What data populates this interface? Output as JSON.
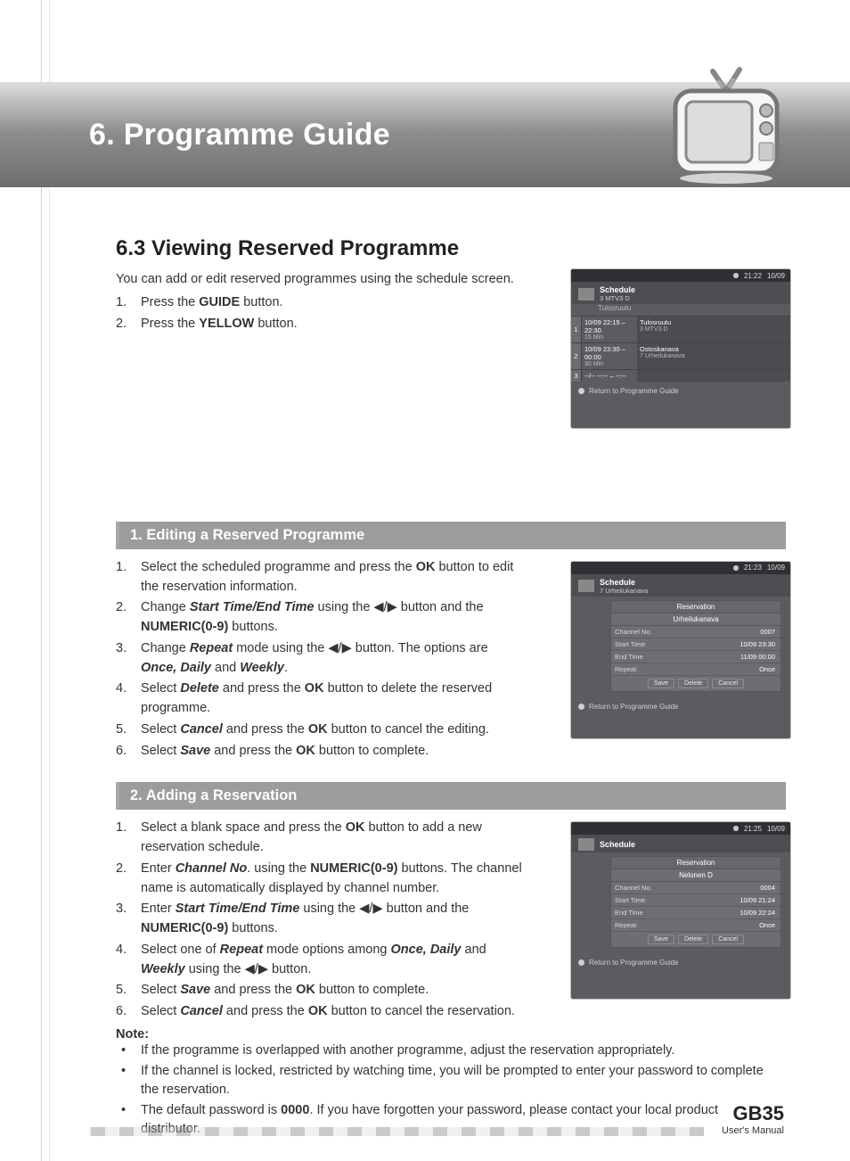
{
  "chapter": {
    "title": "6. Programme Guide"
  },
  "section": {
    "number": "6.3",
    "title": "6.3 Viewing Reserved Programme",
    "intro": "You can add or edit reserved programmes using the schedule screen.",
    "steps": {
      "s1a": "Press the ",
      "s1b": "GUIDE",
      "s1c": " button.",
      "s2a": "Press the ",
      "s2b": "YELLOW",
      "s2c": " button."
    }
  },
  "sub1": {
    "heading": "1. Editing a Reserved Programme",
    "s1a": "Select the scheduled programme and press the ",
    "s1b": "OK",
    "s1c": " button to edit the reservation information.",
    "s2a": "Change ",
    "s2b": "Start Time/End Time",
    "s2c": " using the ",
    "s2d": "◀/▶",
    "s2e": " button and the ",
    "s2f": "NUMERIC(0-9)",
    "s2g": " buttons.",
    "s3a": "Change ",
    "s3b": "Repeat",
    "s3c": " mode using the ",
    "s3d": "◀/▶",
    "s3e": " button. The options are ",
    "s3f": "Once, Daily",
    "s3g": " and ",
    "s3h": "Weekly",
    "s3i": ".",
    "s4a": "Select ",
    "s4b": "Delete",
    "s4c": " and press the ",
    "s4d": "OK",
    "s4e": " button to delete the reserved programme.",
    "s5a": "Select ",
    "s5b": "Cancel",
    "s5c": " and press the ",
    "s5d": "OK",
    "s5e": " button to cancel the editing.",
    "s6a": "Select ",
    "s6b": "Save",
    "s6c": " and press the ",
    "s6d": "OK",
    "s6e": " button to complete."
  },
  "sub2": {
    "heading": "2. Adding a Reservation",
    "s1a": "Select a blank space and press the ",
    "s1b": "OK",
    "s1c": " button to add a new reservation schedule.",
    "s2a": "Enter ",
    "s2b": "Channel No",
    "s2c": ". using the ",
    "s2d": "NUMERIC(0-9)",
    "s2e": " buttons. The channel name is automatically displayed by channel number.",
    "s3a": "Enter ",
    "s3b": "Start Time/End Time",
    "s3c": " using the ",
    "s3d": "◀/▶",
    "s3e": " button and the ",
    "s3f": "NUMERIC(0-9)",
    "s3g": " buttons.",
    "s4a": "Select one of ",
    "s4b": "Repeat",
    "s4c": " mode options among ",
    "s4d": "Once, Daily",
    "s4e": " and ",
    "s4f": "Weekly",
    "s4g": " using the ",
    "s4h": "◀/▶",
    "s4i": " button.",
    "s5a": "Select ",
    "s5b": "Save",
    "s5c": " and press the ",
    "s5d": "OK",
    "s5e": " button to complete.",
    "s6a": "Select ",
    "s6b": "Cancel",
    "s6c": " and press the ",
    "s6d": "OK",
    "s6e": " button to cancel the reservation."
  },
  "note": {
    "label": "Note:",
    "n1": "If the programme is overlapped with another programme, adjust the reservation appropriately.",
    "n2": "If the channel is locked, restricted by watching time, you will be prompted to enter your password to complete the reservation.",
    "n3a": "The default password is ",
    "n3b": "0000",
    "n3c": ". If you have forgotten your password, please contact your local product distributor."
  },
  "footer": {
    "page": "GB35",
    "caption": "User's Manual"
  },
  "shots": {
    "s1": {
      "time": "21:22",
      "date": "10/09",
      "title": "Schedule",
      "ch": "3  MTV3 D",
      "sub": "Tulosruutu",
      "rows": [
        {
          "i": "1",
          "a1": "10/09",
          "a2": "22:15 – 22:30",
          "a3": "15 Min",
          "b1": "Tulosruutu",
          "b2": "3  MTV3 D"
        },
        {
          "i": "2",
          "a1": "10/09",
          "a2": "23:30 – 00:00",
          "a3": "30 Min",
          "b1": "Ostoskanava",
          "b2": "7  Urheilukanava"
        },
        {
          "i": "3",
          "a1": "--/--",
          "a2": "--:-- – --:--",
          "a3": "",
          "b1": "",
          "b2": ""
        }
      ],
      "foot": "Return to Programme Guide"
    },
    "s2": {
      "time": "21:23",
      "date": "10/09",
      "title": "Schedule",
      "ch": "7  Urheilukanava",
      "panelTitle": "Reservation",
      "panelHead": "Urheilukanava",
      "rows": [
        {
          "k": "Channel No.",
          "v": "0007"
        },
        {
          "k": "Start Time",
          "v": "10/09  23:30"
        },
        {
          "k": "End Time",
          "v": "11/09  00:00"
        },
        {
          "k": "Repeat",
          "v": "Once"
        }
      ],
      "btns": {
        "a": "Save",
        "b": "Delete",
        "c": "Cancel"
      },
      "foot": "Return to Programme Guide"
    },
    "s3": {
      "time": "21:25",
      "date": "10/09",
      "title": "Schedule",
      "panelTitle": "Reservation",
      "panelHead": "Nelonen D",
      "rows": [
        {
          "k": "Channel No.",
          "v": "0004"
        },
        {
          "k": "Start Time",
          "v": "10/09  21:24"
        },
        {
          "k": "End Time",
          "v": "10/09  22:24"
        },
        {
          "k": "Repeat",
          "v": "Once"
        }
      ],
      "btns": {
        "a": "Save",
        "b": "Delete",
        "c": "Cancel"
      },
      "foot": "Return to Programme Guide"
    }
  }
}
